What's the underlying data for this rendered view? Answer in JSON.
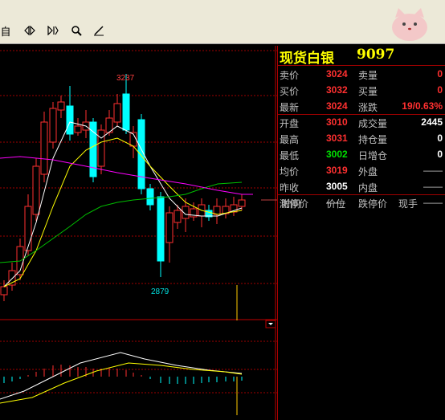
{
  "toolbar": {
    "auto_label": "自",
    "icons": [
      "diamond-nav-icon",
      "step-nav-icon",
      "search-icon",
      "pen-icon"
    ]
  },
  "chart": {
    "high_label": "3237",
    "low_label": "2879"
  },
  "quote": {
    "title": "现货白银",
    "code": "9097",
    "rows": [
      {
        "label": "卖价",
        "value": "3024",
        "label2": "卖量",
        "value2": "0"
      },
      {
        "label": "买价",
        "value": "3032",
        "label2": "买量",
        "value2": "0"
      },
      {
        "label": "最新",
        "value": "3024",
        "label2": "涨跌",
        "value2": "19/0.63%"
      }
    ],
    "stats": [
      {
        "label": "开盘",
        "value": "3010",
        "label2": "成交量",
        "value2": "2445"
      },
      {
        "label": "最高",
        "value": "3031",
        "label2": "持仓量",
        "value2": "0"
      },
      {
        "label": "最低",
        "value": "3002",
        "label2": "日增仓",
        "value2": "0"
      },
      {
        "label": "均价",
        "value": "3019",
        "label2": "外盘",
        "value2": "——"
      },
      {
        "label": "昨收",
        "value": "3005",
        "label2": "内盘",
        "value2": "——"
      },
      {
        "label": "涨停价",
        "value": "——",
        "label2": "跌停价",
        "value2": "——"
      }
    ],
    "trade_headers": {
      "time": "时间",
      "price": "价位",
      "volume": "现手"
    }
  },
  "colors": {
    "up": "#ff3030",
    "down": "#00ffff",
    "ma5": "#ffffff",
    "ma10": "#ffff00",
    "ma20": "#00c000",
    "ma60": "#ff00ff",
    "title": "#ffff00"
  }
}
